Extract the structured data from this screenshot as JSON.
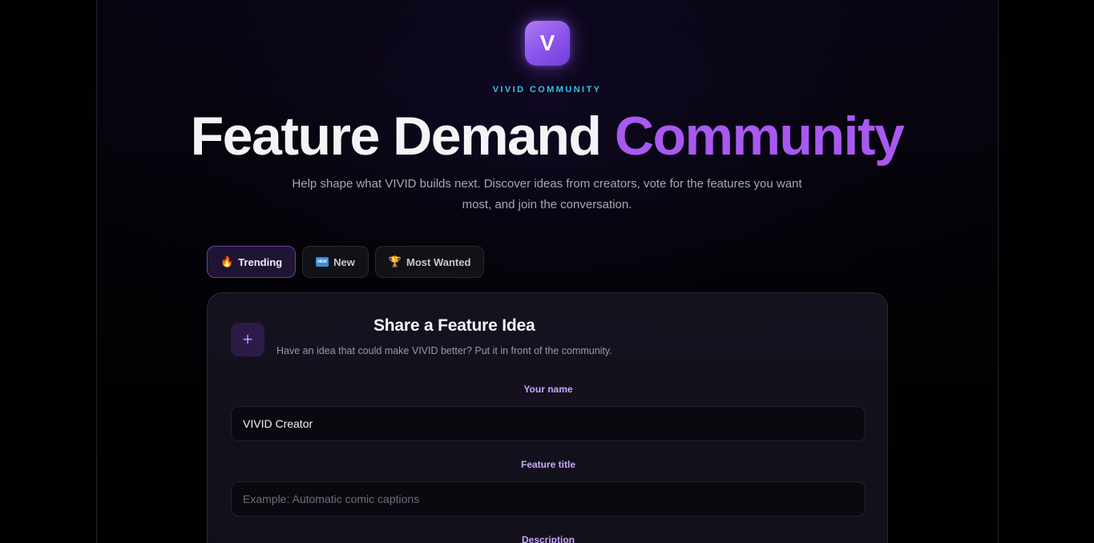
{
  "brand": {
    "logo_letter": "V",
    "eyebrow": "VIVID COMMUNITY"
  },
  "hero": {
    "title_part1": "Feature Demand",
    "title_part2": "Community",
    "subtitle": "Help shape what VIVID builds next. Discover ideas from creators, vote for the features you want most, and join the conversation."
  },
  "tabs": [
    {
      "emoji": "🔥",
      "label": "Trending",
      "active": true
    },
    {
      "emoji": "NEW",
      "label": "New",
      "active": false
    },
    {
      "emoji": "🏆",
      "label": "Most Wanted",
      "active": false
    }
  ],
  "form": {
    "icon": "+",
    "title": "Share a Feature Idea",
    "description": "Have an idea that could make VIVID better? Put it in front of the community.",
    "name_label": "Your name",
    "name_value": "VIVID Creator",
    "title_label": "Feature title",
    "title_placeholder": "Example: Automatic comic captions",
    "description_label": "Description"
  },
  "colors": {
    "accent_purple": "#a859f0",
    "eyebrow_cyan": "#33c2e8",
    "label_lavender": "#c9a6ff"
  }
}
